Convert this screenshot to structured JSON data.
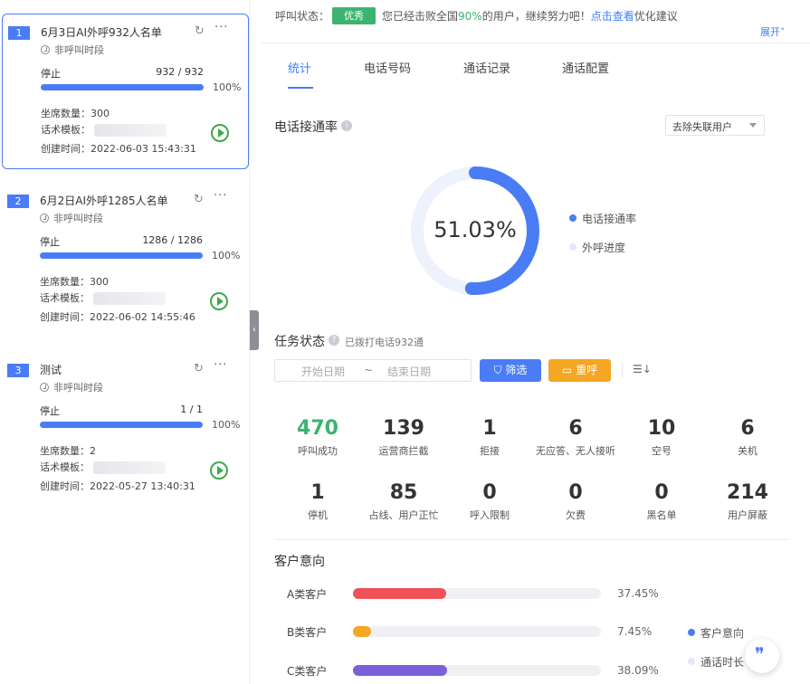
{
  "status": {
    "label": "呼叫状态：",
    "badge": "优秀",
    "msg_pre": "您已经击败全国",
    "msg_pct": "90%",
    "msg_post": "的用户，继续努力吧！",
    "link": "点击查看",
    "link_post": "优化建议",
    "expand": "展开",
    "badge_color": "#3cb371"
  },
  "tasks": [
    {
      "index": "1",
      "title": "6月3日AI外呼932人名单",
      "period": "非呼叫时段",
      "state": "停止",
      "count": "932 / 932",
      "progress": "100%",
      "progress_value": 1.0,
      "seats_label": "坐席数量：",
      "seats": "300",
      "template_label": "话术模板：",
      "created_label": "创建时间：",
      "created": "2022-06-03 15:43:31"
    },
    {
      "index": "2",
      "title": "6月2日AI外呼1285人名单",
      "period": "非呼叫时段",
      "state": "停止",
      "count": "1286 / 1286",
      "progress": "100%",
      "progress_value": 1.0,
      "seats_label": "坐席数量：",
      "seats": "300",
      "template_label": "话术模板：",
      "created_label": "创建时间：",
      "created": "2022-06-02 14:55:46"
    },
    {
      "index": "3",
      "title": "测试",
      "period": "非呼叫时段",
      "state": "停止",
      "count": "1 / 1",
      "progress": "100%",
      "progress_value": 1.0,
      "seats_label": "坐席数量：",
      "seats": "2",
      "template_label": "话术模板：",
      "created_label": "创建时间：",
      "created": "2022-05-27 13:40:31"
    }
  ],
  "tabs": [
    "统计",
    "电话号码",
    "通话记录",
    "通话配置"
  ],
  "connect": {
    "title": "电话接通率",
    "select": "去除失联用户",
    "value_text": "51.03%",
    "value": 51.03,
    "legend_a": "电话接通率",
    "legend_b": "外呼进度",
    "color_a": "#4a7cf6",
    "color_b": "#eef2fd"
  },
  "task_status": {
    "title": "任务状态",
    "note": "已拨打电话932通",
    "date_start": "开始日期",
    "date_sep": "~",
    "date_end": "结束日期",
    "filter": "筛选",
    "redial": "重呼",
    "stats": [
      {
        "v": "470",
        "l": "呼叫成功"
      },
      {
        "v": "139",
        "l": "运营商拦截"
      },
      {
        "v": "1",
        "l": "拒接"
      },
      {
        "v": "6",
        "l": "无应答、无人接听"
      },
      {
        "v": "10",
        "l": "空号"
      },
      {
        "v": "6",
        "l": "关机"
      },
      {
        "v": "1",
        "l": "停机"
      },
      {
        "v": "85",
        "l": "占线、用户正忙"
      },
      {
        "v": "0",
        "l": "呼入限制"
      },
      {
        "v": "0",
        "l": "欠费"
      },
      {
        "v": "0",
        "l": "黑名单"
      },
      {
        "v": "214",
        "l": "用户屏蔽"
      }
    ]
  },
  "intent": {
    "title": "客户意向",
    "rows": [
      {
        "label": "A类客户",
        "pct": "37.45%",
        "value": 37.45,
        "color": "#f0525a"
      },
      {
        "label": "B类客户",
        "pct": "7.45%",
        "value": 7.45,
        "color": "#f5a623"
      },
      {
        "label": "C类客户",
        "pct": "38.09%",
        "value": 38.09,
        "color": "#7b61d9"
      }
    ],
    "legend_a": "客户意向",
    "legend_b": "通话时长"
  }
}
